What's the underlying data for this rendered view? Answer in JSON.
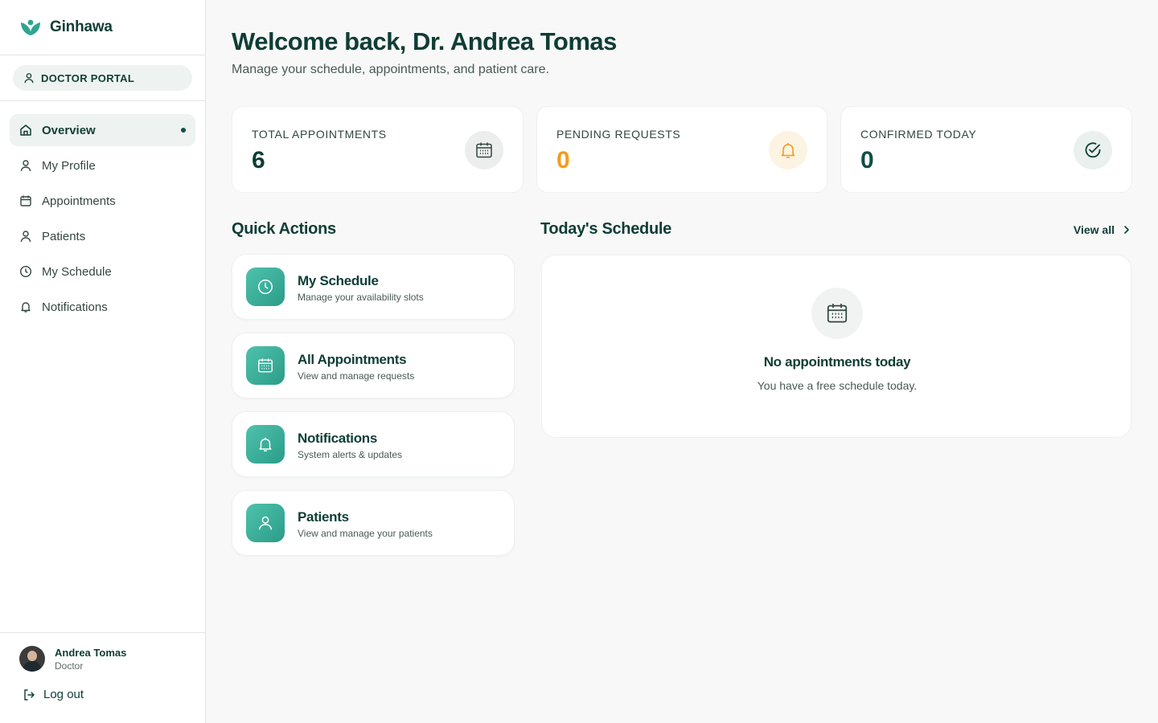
{
  "brand": {
    "name": "Ginhawa"
  },
  "portal": {
    "label": "DOCTOR PORTAL"
  },
  "sidebar": {
    "items": [
      {
        "label": "Overview",
        "icon": "home-icon"
      },
      {
        "label": "My Profile",
        "icon": "user-icon"
      },
      {
        "label": "Appointments",
        "icon": "calendar-icon"
      },
      {
        "label": "Patients",
        "icon": "user-icon"
      },
      {
        "label": "My Schedule",
        "icon": "clock-icon"
      },
      {
        "label": "Notifications",
        "icon": "bell-icon"
      }
    ]
  },
  "user": {
    "name": "Andrea Tomas",
    "role": "Doctor",
    "logout_label": "Log out"
  },
  "header": {
    "title": "Welcome back, Dr. Andrea Tomas",
    "subtitle": "Manage your schedule, appointments, and patient care."
  },
  "stats": [
    {
      "label": "TOTAL APPOINTMENTS",
      "value": "6",
      "color": "#0f3d35",
      "icon": "calendar-icon"
    },
    {
      "label": "PENDING REQUESTS",
      "value": "0",
      "color": "#f29d1b",
      "icon": "bell-icon"
    },
    {
      "label": "CONFIRMED TODAY",
      "value": "0",
      "color": "#0f4f45",
      "icon": "check-circle-icon"
    }
  ],
  "quick_actions": {
    "title": "Quick Actions",
    "items": [
      {
        "title": "My Schedule",
        "subtitle": "Manage your availability slots",
        "icon": "clock-icon"
      },
      {
        "title": "All Appointments",
        "subtitle": "View and manage requests",
        "icon": "calendar-icon"
      },
      {
        "title": "Notifications",
        "subtitle": "System alerts & updates",
        "icon": "bell-icon"
      },
      {
        "title": "Patients",
        "subtitle": "View and manage your patients",
        "icon": "user-icon"
      }
    ]
  },
  "schedule": {
    "title": "Today's Schedule",
    "view_all_label": "View all",
    "empty_title": "No appointments today",
    "empty_subtitle": "You have a free schedule today."
  },
  "colors": {
    "accent": "#2ea592",
    "primary": "#0f3d35",
    "pending": "#f29d1b"
  }
}
